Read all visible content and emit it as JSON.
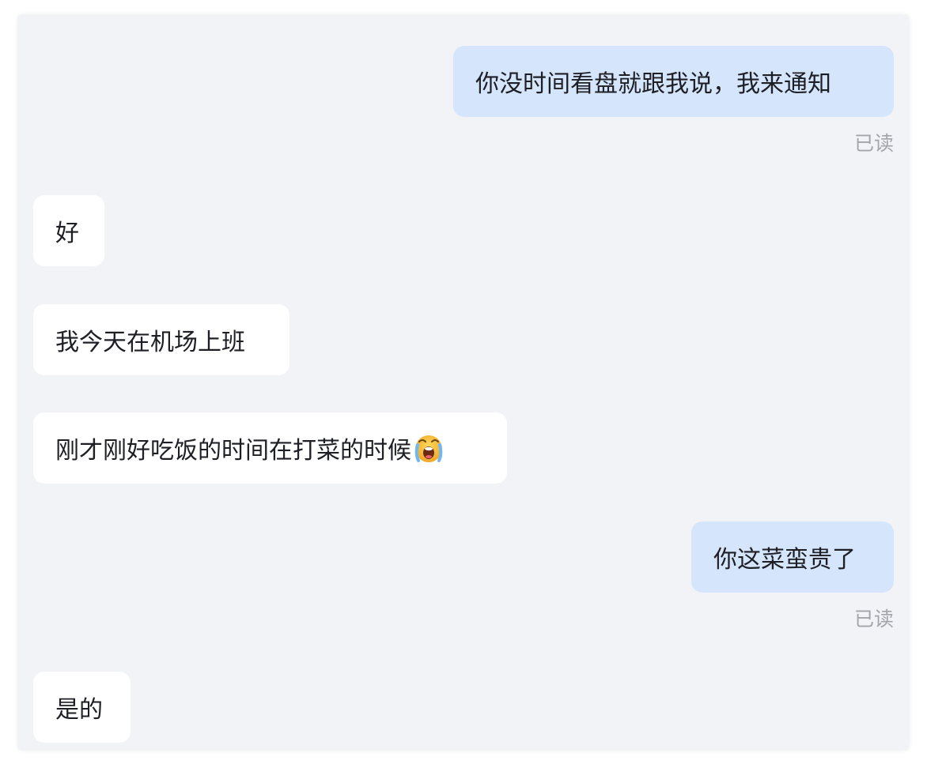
{
  "messages": [
    {
      "direction": "out",
      "text": "你没时间看盘就跟我说，我来通知",
      "status": "已读"
    },
    {
      "direction": "in",
      "text": "好"
    },
    {
      "direction": "in",
      "text": "我今天在机场上班"
    },
    {
      "direction": "in",
      "text": "刚才刚好吃饭的时间在打菜的时候",
      "emoji": "loudly-crying-face"
    },
    {
      "direction": "out",
      "text": "你这菜蛮贵了",
      "status": "已读"
    },
    {
      "direction": "in",
      "text": "是的"
    }
  ],
  "colors": {
    "background": "#f2f3f7",
    "outgoing_bubble": "#d5e5fc",
    "incoming_bubble": "#ffffff",
    "read_status": "#a3a5ab",
    "text": "#1e1f24"
  }
}
